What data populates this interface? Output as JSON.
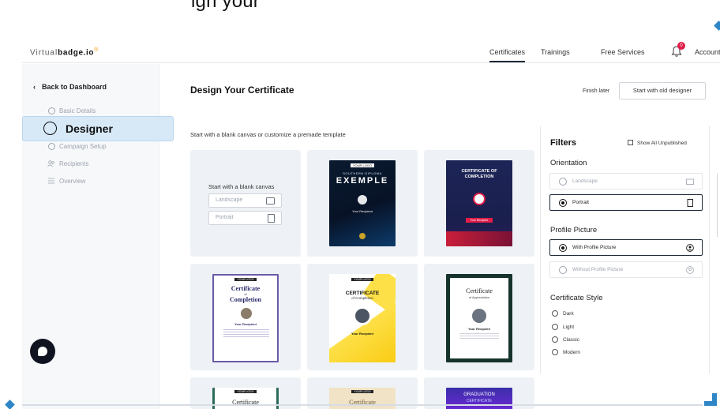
{
  "top_heading": "ign your",
  "app": {
    "logo_light": "Virtual",
    "logo_bold": "badge.io",
    "logo_mark": "®"
  },
  "nav": {
    "items": [
      "Certificates",
      "Trainings",
      "Free Services"
    ],
    "active": "Certificates",
    "notification_count": "0",
    "account_label": "Account"
  },
  "sidebar": {
    "back_label": "Back to Dashboard",
    "steps": [
      "Basic Details",
      "Designer",
      "Campaign Setup",
      "Recipients",
      "Overview"
    ],
    "current_step": "Designer"
  },
  "main": {
    "title": "Design Your Certificate",
    "finish_later": "Finish later",
    "start_old": "Start with old designer",
    "subtitle": "Start with a blank canvas or customize a premade template",
    "blank_canvas": {
      "title": "Start with a blank canvas",
      "landscape": "Landscape",
      "portrait": "Portrait"
    },
    "templates": [
      {
        "logo": "YOUR LOGO",
        "line1": "SOUTHERN DIPLOMA",
        "line2": "EXEMPLE",
        "name": "Your Recipient",
        "style": "dark-blue"
      },
      {
        "line1": "CERTIFICATE OF",
        "line2": "COMPLETION",
        "name": "Your Recipient",
        "style": "navy-red"
      },
      {
        "logo": "YOUR LOGO",
        "line1": "Certificate",
        "line2": "of",
        "line3": "Completion",
        "name": "Your Recipient",
        "style": "lavender"
      },
      {
        "logo": "YOUR LOGO",
        "line1": "CERTIFICATE",
        "line2": "of Completion",
        "name": "Your Recipient",
        "style": "yellow"
      },
      {
        "line1": "Certificate",
        "line2": "of Appreciation",
        "name": "Your Recipient",
        "style": "green-border"
      },
      {
        "logo": "YOUR LOGO",
        "line1": "Certificate",
        "style": "green-ornate"
      },
      {
        "logo": "YOUR LOGO",
        "line1": "Certificate",
        "style": "beige"
      },
      {
        "line1": "GRADUATION",
        "line2": "CERTIFICATE",
        "style": "purple"
      }
    ]
  },
  "filters": {
    "title": "Filters",
    "show_all": "Show All Unpublished",
    "orientation_label": "Orientation",
    "orientation": [
      {
        "label": "Landscape",
        "selected": false
      },
      {
        "label": "Portrait",
        "selected": true
      }
    ],
    "profile_label": "Profile Picture",
    "profile": [
      {
        "label": "With Profile Picture",
        "selected": true
      },
      {
        "label": "Without Profile Picture",
        "selected": false
      }
    ],
    "style_label": "Certificate Style",
    "styles": [
      "Dark",
      "Light",
      "Classic",
      "Modern"
    ]
  },
  "colors": {
    "accent": "#2f86c6",
    "sidebar_bg": "#f7f8fa",
    "selected_step_bg": "#d7e8f7",
    "tile_bg": "#eef2f6",
    "badge": "#e11d48"
  }
}
